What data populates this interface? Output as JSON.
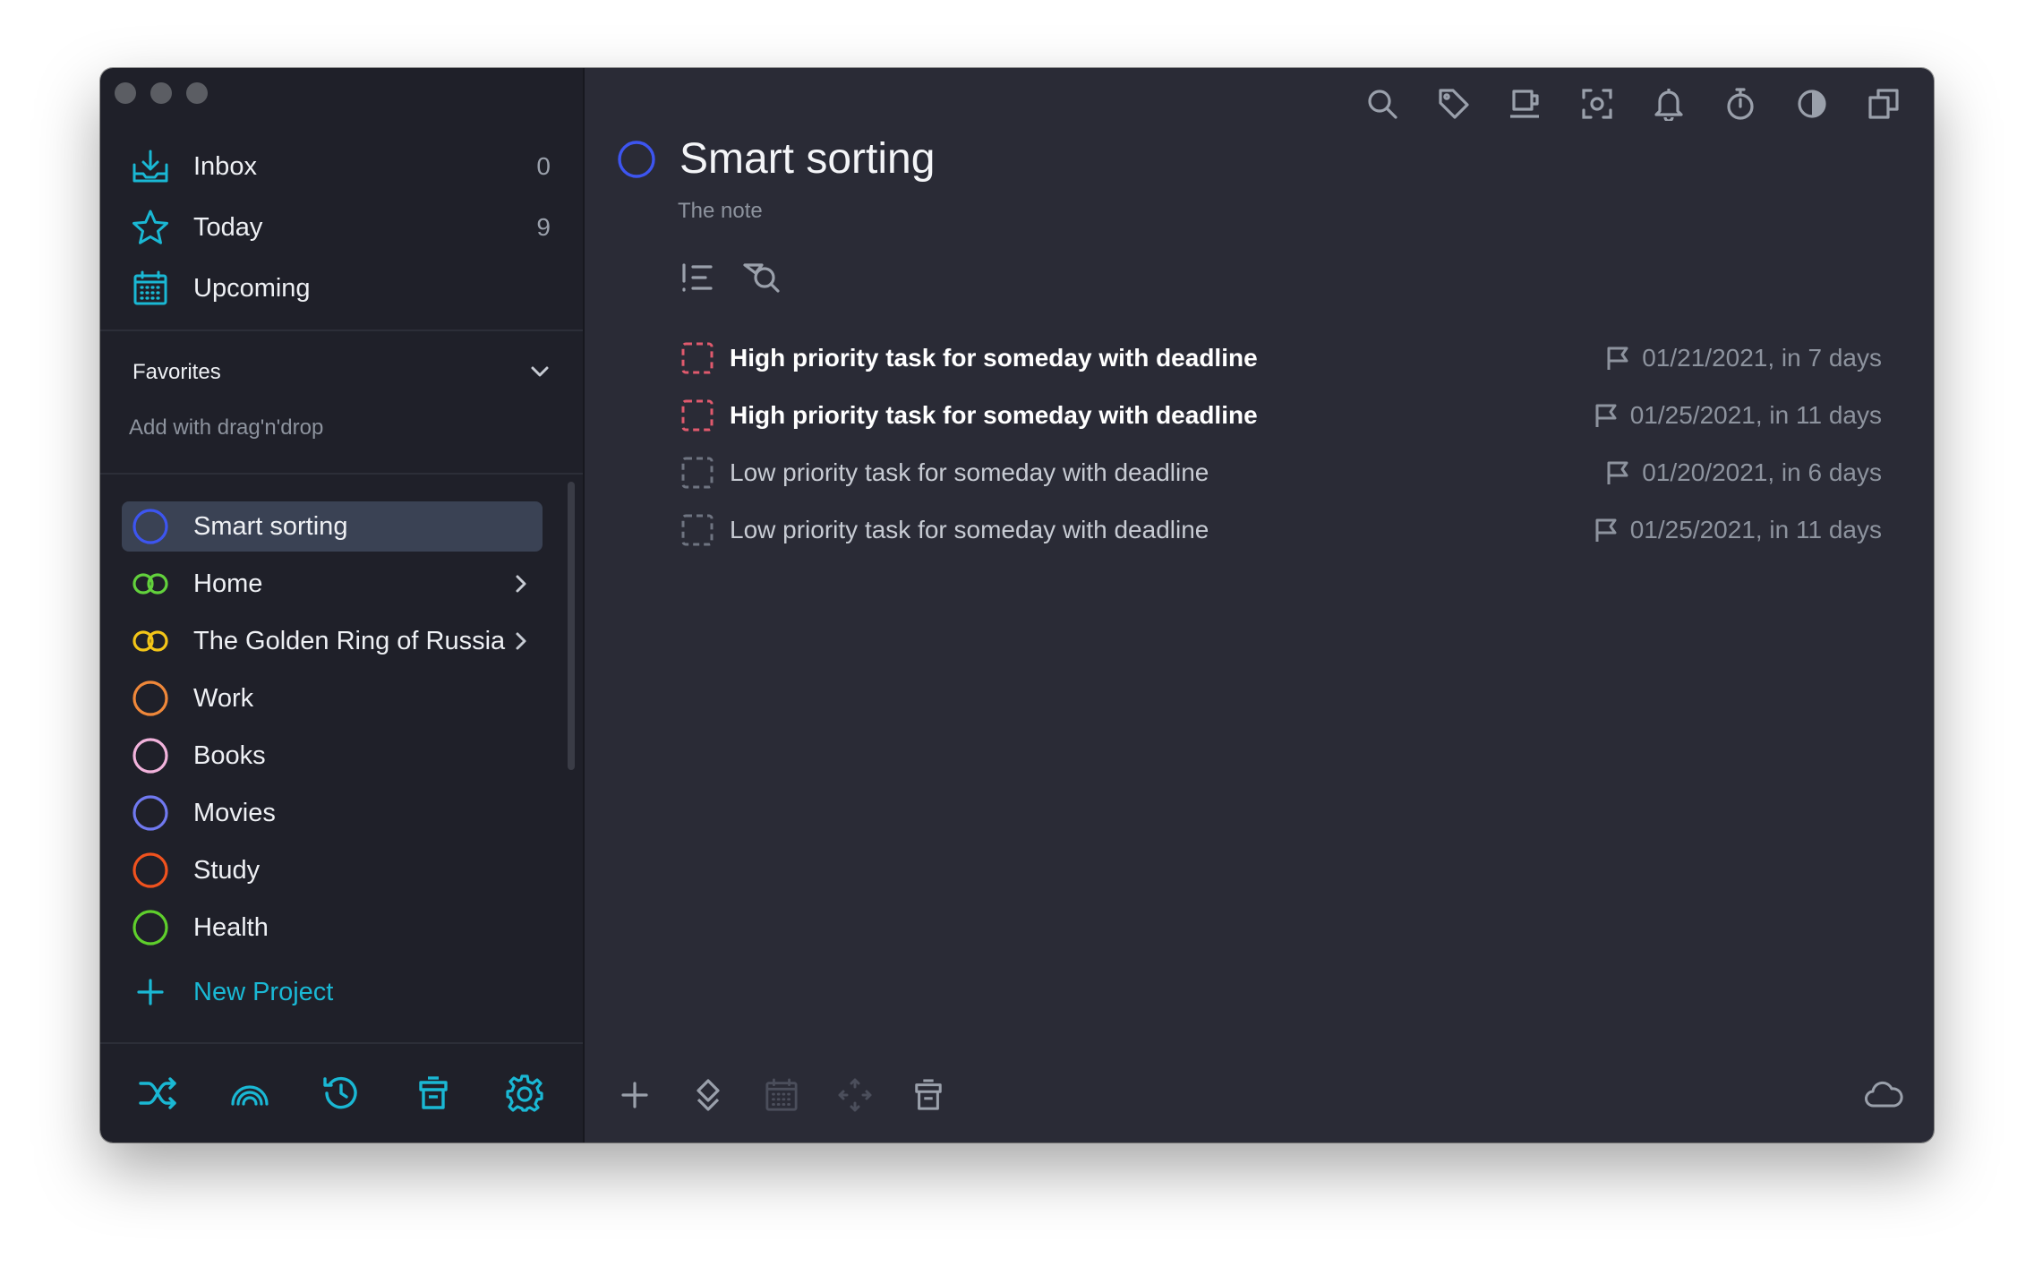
{
  "colors": {
    "accent": "#1ab8d4",
    "high_priority": "#e05a6d",
    "low_priority": "#6f7481"
  },
  "window": {
    "traffic_lights": [
      "close",
      "minimize",
      "zoom"
    ]
  },
  "nav": [
    {
      "label": "Inbox",
      "count": "0",
      "icon": "inbox-icon"
    },
    {
      "label": "Today",
      "count": "9",
      "icon": "star-icon"
    },
    {
      "label": "Upcoming",
      "count": "",
      "icon": "calendar-icon"
    }
  ],
  "favorites": {
    "title": "Favorites",
    "hint": "Add with drag'n'drop"
  },
  "projects": [
    {
      "label": "Smart sorting",
      "color": "#3d55f0",
      "kind": "circle",
      "active": true
    },
    {
      "label": "Home",
      "color": "#62d13c",
      "kind": "rings",
      "chevron": true
    },
    {
      "label": "The Golden Ring of Russia",
      "color": "#f3c518",
      "kind": "rings",
      "chevron": true
    },
    {
      "label": "Work",
      "color": "#f0883a",
      "kind": "circle"
    },
    {
      "label": "Books",
      "color": "#f2b3dc",
      "kind": "circle"
    },
    {
      "label": "Movies",
      "color": "#7079f0",
      "kind": "circle"
    },
    {
      "label": "Study",
      "color": "#f0521e",
      "kind": "circle"
    },
    {
      "label": "Health",
      "color": "#5fcf2c",
      "kind": "circle"
    }
  ],
  "new_project": {
    "label": "New Project"
  },
  "main": {
    "title": "Smart sorting",
    "note": "The note",
    "tasks": [
      {
        "title": "High priority task for someday with deadline",
        "due": "01/21/2021, in 7 days",
        "priority": "high"
      },
      {
        "title": "High priority task for someday with deadline",
        "due": "01/25/2021, in 11 days",
        "priority": "high"
      },
      {
        "title": "Low priority task for someday with deadline",
        "due": "01/20/2021, in 6 days",
        "priority": "low"
      },
      {
        "title": "Low priority task for someday with deadline",
        "due": "01/25/2021, in 11 days",
        "priority": "low"
      }
    ]
  }
}
